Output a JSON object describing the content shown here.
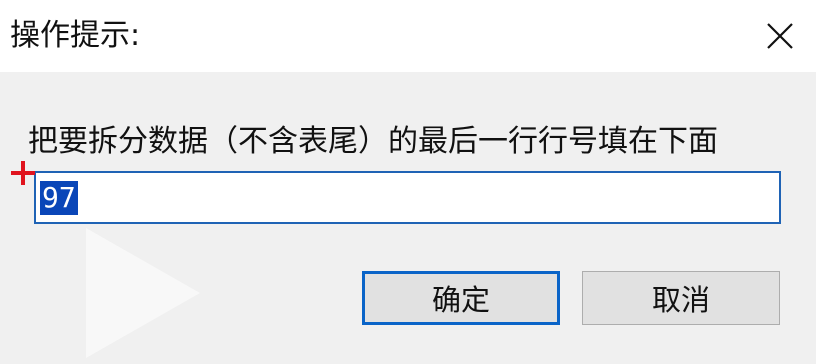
{
  "window": {
    "title": "操作提示:",
    "close_icon": "close-icon"
  },
  "prompt": {
    "text": "把要拆分数据（不含表尾）的最后一行行号填在下面"
  },
  "input": {
    "value": "97"
  },
  "buttons": {
    "ok_label": "确定",
    "cancel_label": "取消"
  },
  "colors": {
    "selection": "#0a46b8",
    "ok_border": "#0a64c8",
    "crosshair": "#e0141e"
  }
}
